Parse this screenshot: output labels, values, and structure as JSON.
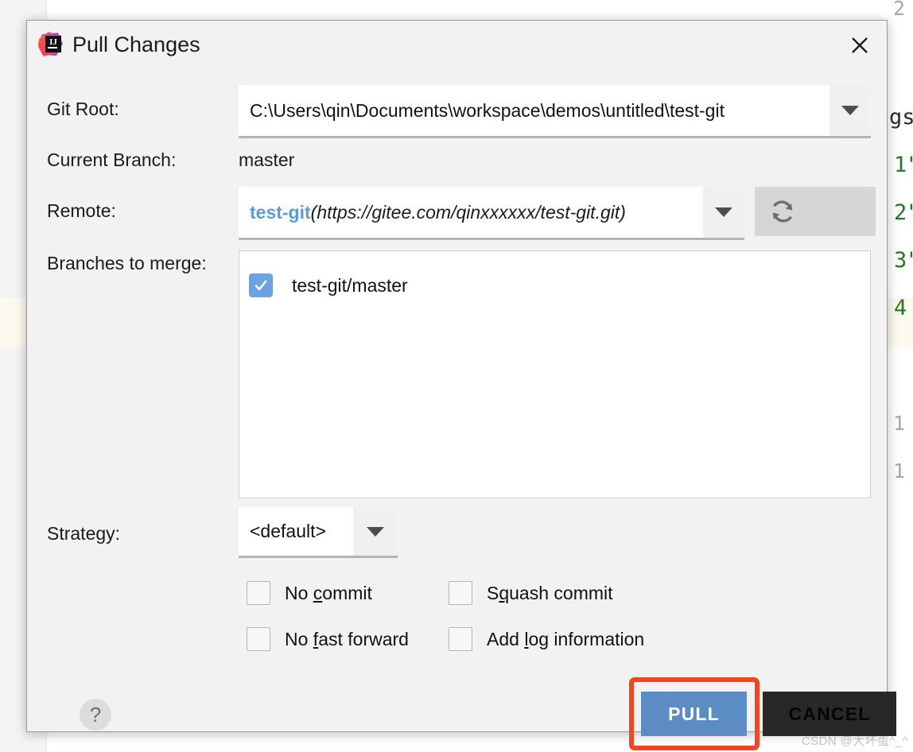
{
  "background": {
    "gutter_line_numbers": [
      "2",
      "1",
      "1"
    ],
    "code_tokens": [
      {
        "text": "gs",
        "color": "#2b2b2b"
      },
      {
        "text": "1\"",
        "color": "#227a22"
      },
      {
        "text": "2\"",
        "color": "#227a22"
      },
      {
        "text": "3\"",
        "color": "#227a22"
      },
      {
        "text": "4",
        "color": "#227a22"
      }
    ],
    "watermark": "CSDN @大坏蛋^_^"
  },
  "dialog": {
    "title": "Pull Changes",
    "app_icon": "intellij-idea-logo",
    "close_icon": "close-icon",
    "fields": {
      "git_root": {
        "label": "Git Root:",
        "value": "C:\\Users\\qin\\Documents\\workspace\\demos\\untitled\\test-git"
      },
      "current_branch": {
        "label": "Current Branch:",
        "value": "master"
      },
      "remote": {
        "label": "Remote:",
        "name": "test-git",
        "url": "(https://gitee.com/qinxxxxxx/test-git.git)",
        "refresh_icon": "refresh-icon"
      },
      "branches_to_merge": {
        "label": "Branches to merge:",
        "items": [
          {
            "label": "test-git/master",
            "checked": true
          }
        ]
      },
      "strategy": {
        "label": "Strategy:",
        "value": "<default>"
      }
    },
    "options": [
      {
        "pre": "No ",
        "mnemonic": "c",
        "post": "ommit",
        "checked": false
      },
      {
        "pre": "S",
        "mnemonic": "q",
        "post": "uash commit",
        "checked": false
      },
      {
        "pre": "No ",
        "mnemonic": "f",
        "post": "ast forward",
        "checked": false
      },
      {
        "pre": "Add ",
        "mnemonic": "l",
        "post": "og information",
        "checked": false
      }
    ],
    "footer": {
      "help_label": "?",
      "pull_label": "PULL",
      "cancel_label": "CANCEL"
    },
    "colors": {
      "accent_blue": "#5b8cc4",
      "remote_link": "#5e9bd6",
      "checkbox_checked": "#6aa3e0",
      "annotation_red": "#ef4723",
      "cancel_dark": "#282828"
    }
  }
}
